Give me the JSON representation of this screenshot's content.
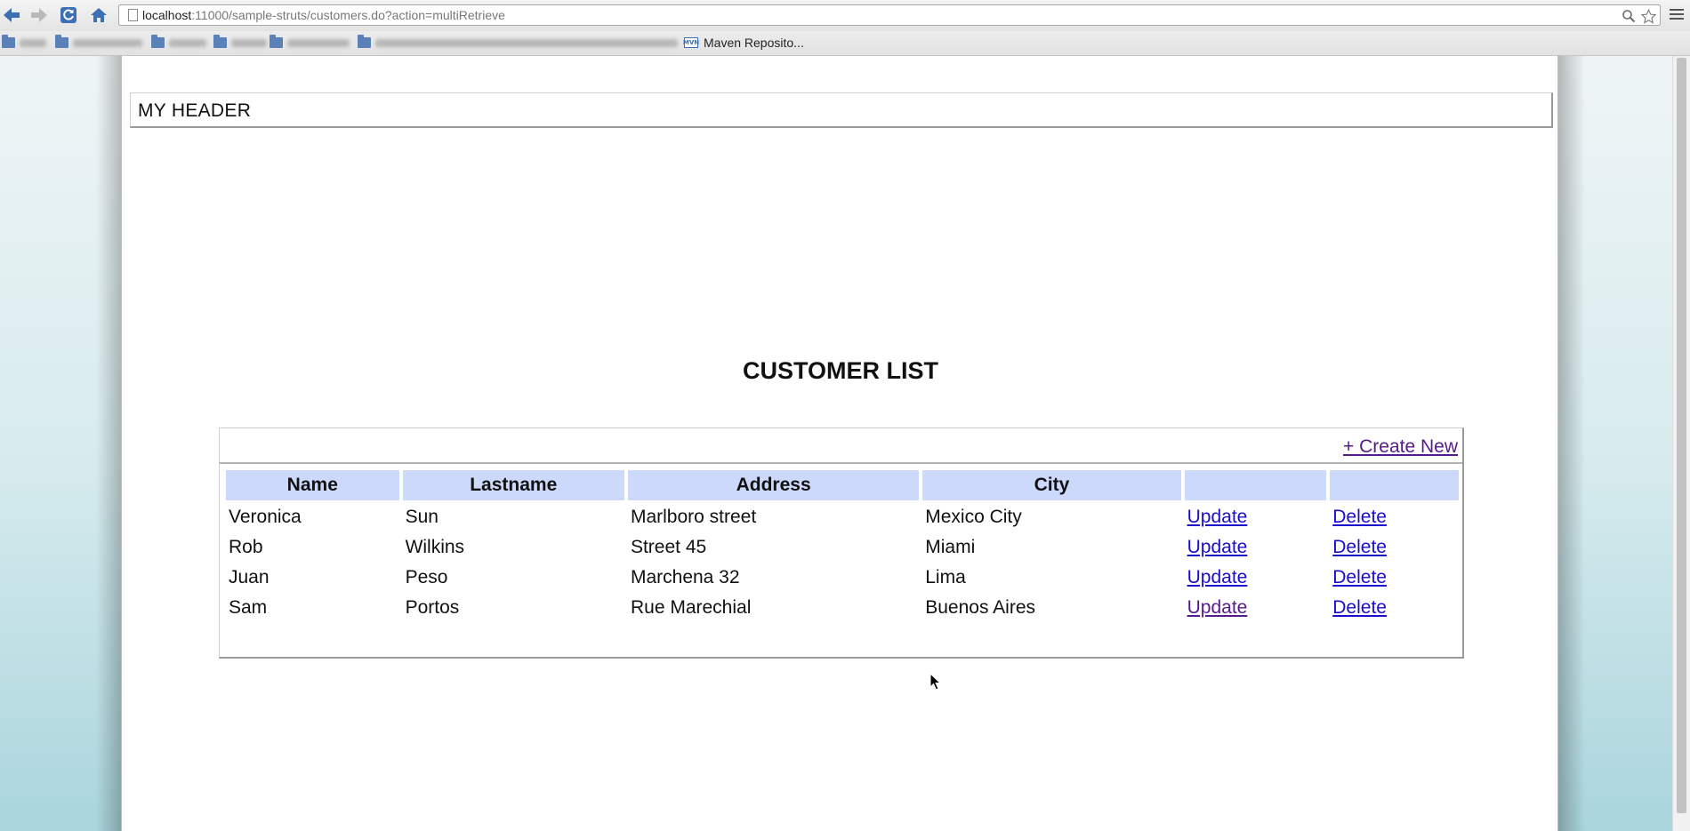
{
  "browser": {
    "url_host": "localhost",
    "url_rest": ":11000/sample-struts/customers.do?action=multiRetrieve",
    "bookmarks": {
      "maven_label": "Maven Reposito...",
      "maven_icon_text": "MVN"
    }
  },
  "page": {
    "header": "MY HEADER",
    "title": "CUSTOMER LIST",
    "create_link": "+ Create New",
    "table": {
      "columns": [
        "Name",
        "Lastname",
        "Address",
        "City",
        "",
        ""
      ],
      "rows": [
        {
          "name": "Veronica",
          "lastname": "Sun",
          "address": "Marlboro street",
          "city": "Mexico City",
          "update": "Update",
          "delete": "Delete"
        },
        {
          "name": "Rob",
          "lastname": "Wilkins",
          "address": "Street 45",
          "city": "Miami",
          "update": "Update",
          "delete": "Delete"
        },
        {
          "name": "Juan",
          "lastname": "Peso",
          "address": "Marchena 32",
          "city": "Lima",
          "update": "Update",
          "delete": "Delete"
        },
        {
          "name": "Sam",
          "lastname": "Portos",
          "address": "Rue Marechial",
          "city": "Buenos Aires",
          "update": "Update",
          "delete": "Delete"
        }
      ]
    }
  },
  "colors": {
    "header_cell_bg": "#ccd9fb",
    "link": "#1a0dcc",
    "visited_link": "#551a8b"
  },
  "icons": [
    "back-arrow-icon",
    "forward-arrow-icon",
    "reload-icon",
    "home-icon",
    "page-icon",
    "zoom-icon",
    "star-icon",
    "menu-icon",
    "folder-icon",
    "mouse-cursor-icon"
  ]
}
